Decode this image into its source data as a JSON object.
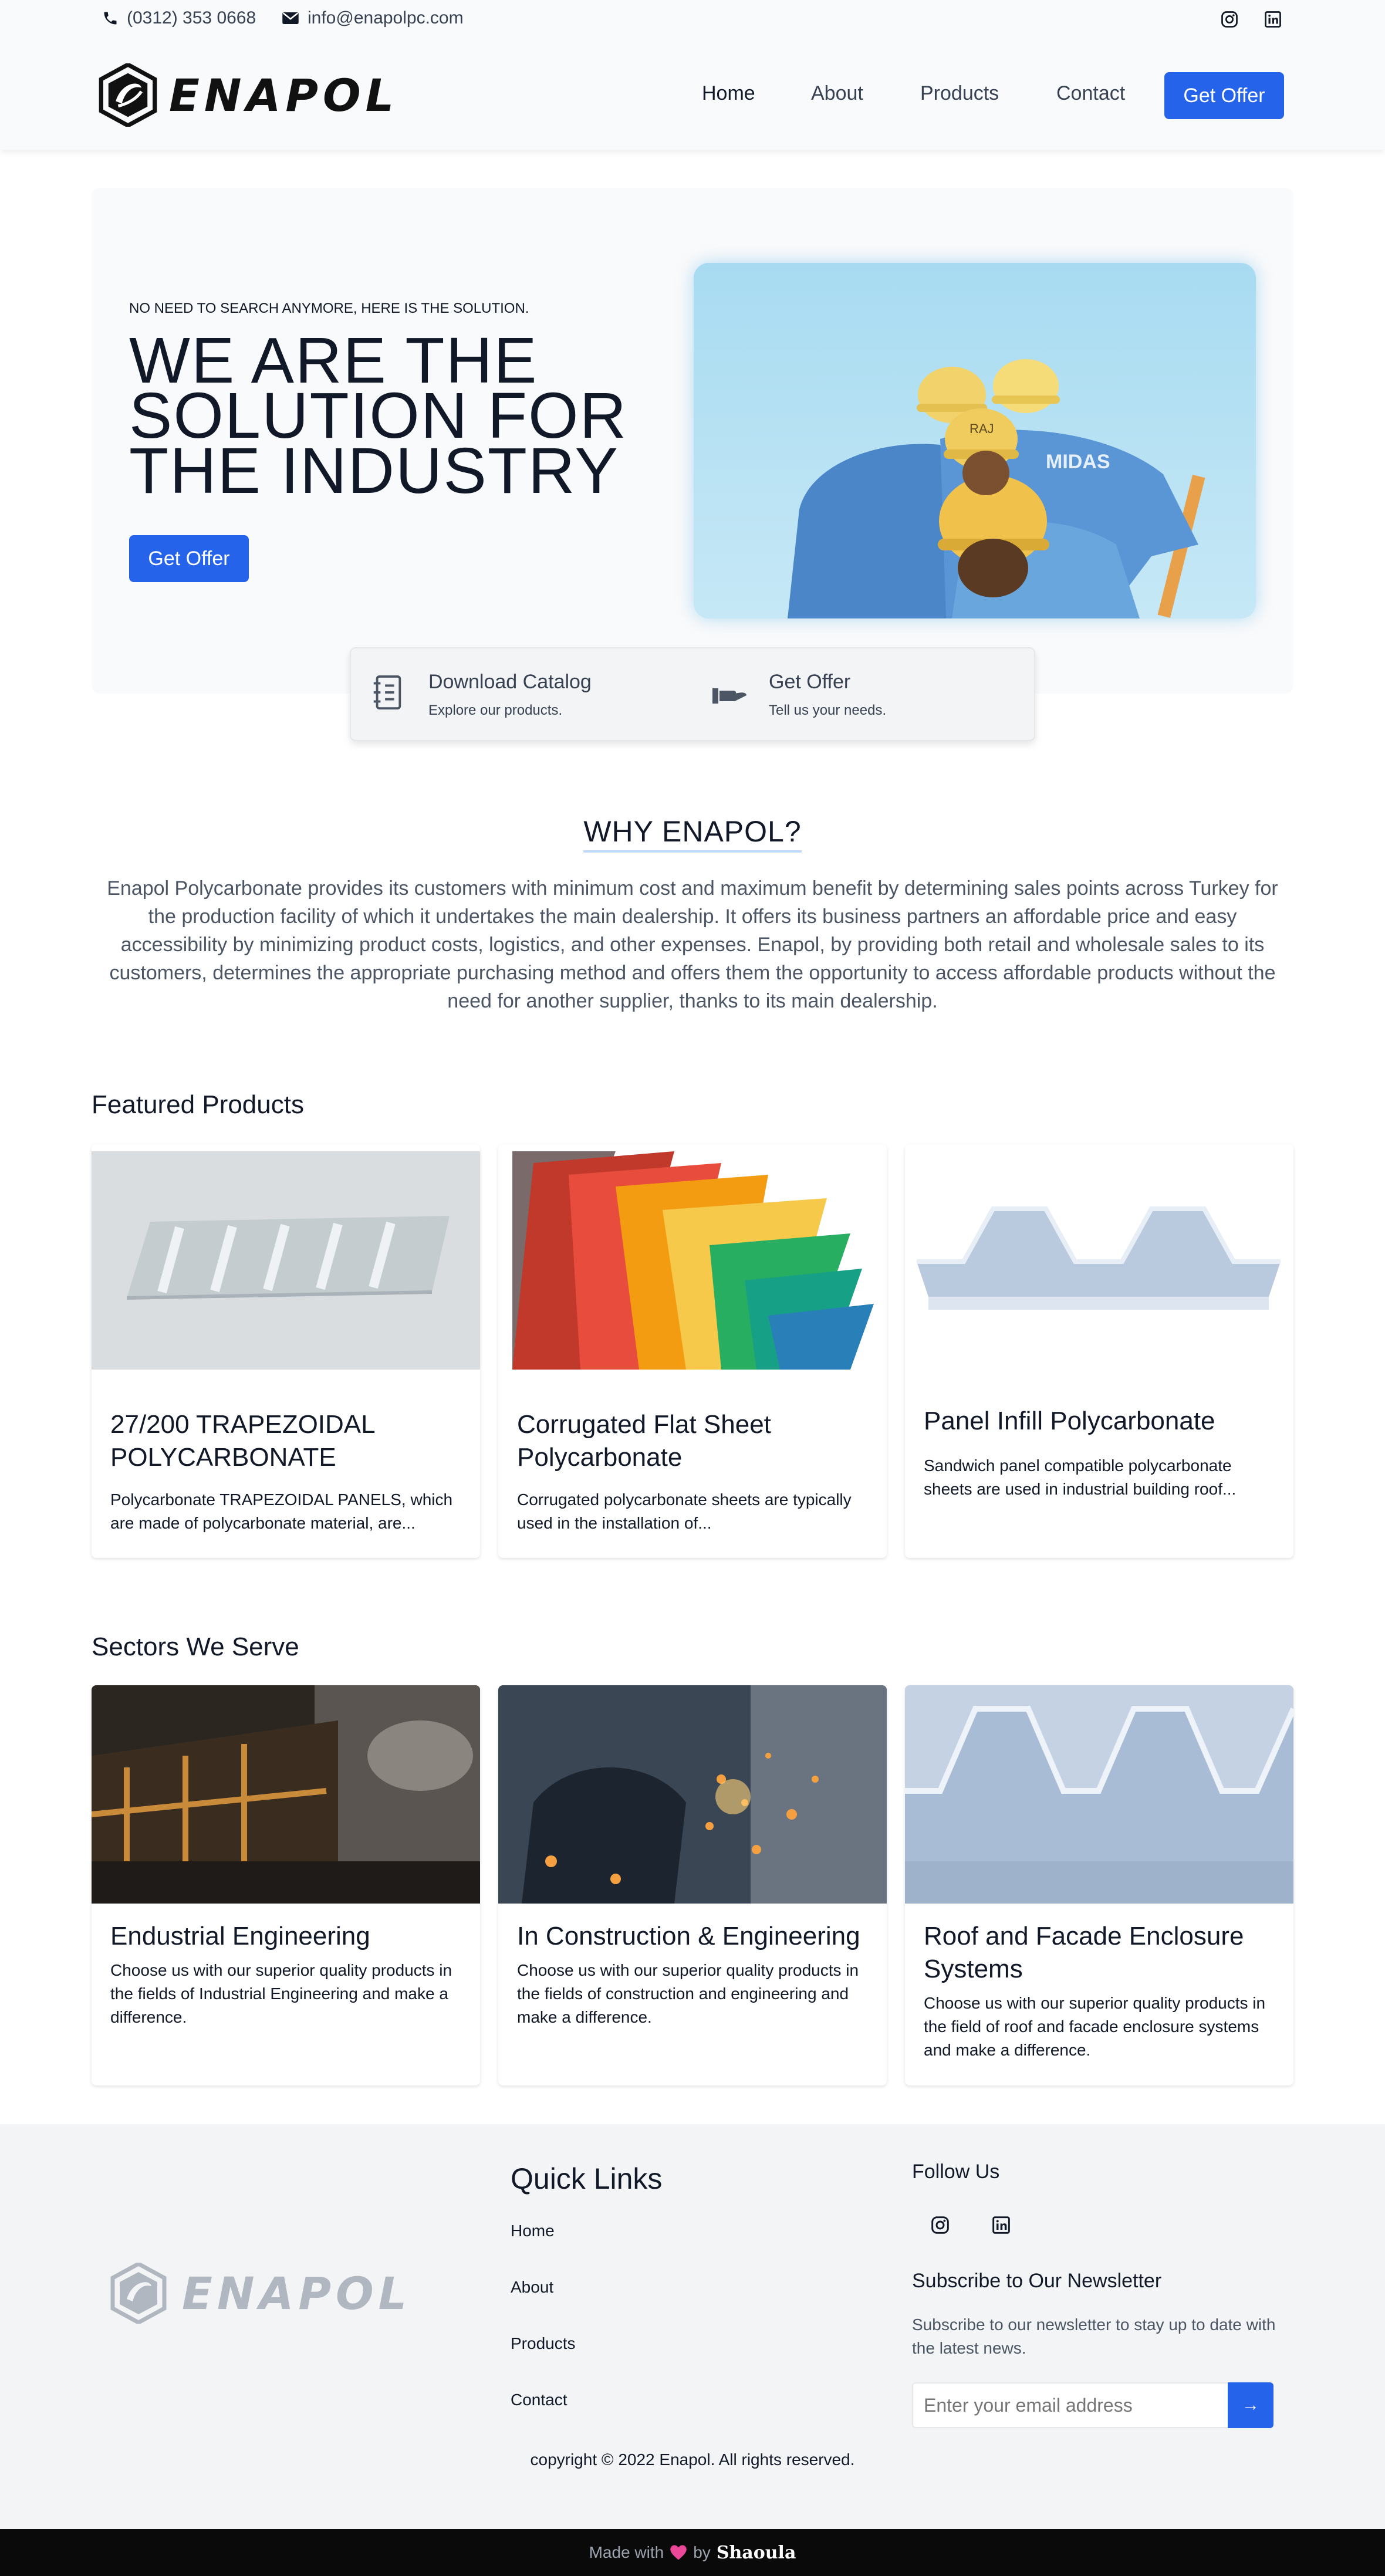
{
  "topbar": {
    "phone": "(0312) 353 0668",
    "email": "info@enapolpc.com"
  },
  "brand": {
    "name": "ENAPOL",
    "logo_icon": "enapol-hexagon-logo"
  },
  "nav": {
    "home": "Home",
    "about": "About",
    "products": "Products",
    "contact": "Contact",
    "cta": "Get Offer"
  },
  "hero": {
    "eyebrow": "NO NEED TO SEARCH ANYMORE, HERE IS THE SOLUTION.",
    "title": "WE ARE THE SOLUTION FOR THE INDUSTRY",
    "cta": "Get Offer"
  },
  "quick": [
    {
      "icon": "catalog-notebook-icon",
      "title": "Download Catalog",
      "subtitle": "Explore our products."
    },
    {
      "icon": "hand-offer-icon",
      "title": "Get Offer",
      "subtitle": "Tell us your needs."
    }
  ],
  "why": {
    "title": "WHY ENAPOL?",
    "body": "Enapol Polycarbonate provides its customers with minimum cost and maximum benefit by determining sales points across Turkey for the production facility of which it undertakes the main dealership. It offers its business partners an affordable price and easy accessibility by minimizing product costs, logistics, and other expenses. Enapol, by providing both retail and wholesale sales to its customers, determines the appropriate purchasing method and offers them the opportunity to access affordable products without the need for another supplier, thanks to its main dealership."
  },
  "featured": {
    "title": "Featured Products",
    "items": [
      {
        "title": "27/200 TRAPEZOIDAL POLYCARBONATE",
        "desc": "Polycarbonate TRAPEZOIDAL PANELS, which are made of polycarbonate material, are..."
      },
      {
        "title": "Corrugated Flat Sheet Polycarbonate",
        "desc": "Corrugated polycarbonate sheets are typically used in the installation of..."
      },
      {
        "title": "Panel Infill Polycarbonate",
        "desc": "Sandwich panel compatible polycarbonate sheets are used in industrial building roof..."
      }
    ]
  },
  "sectors": {
    "title": "Sectors We Serve",
    "items": [
      {
        "title": "Endustrial Engineering",
        "desc": "Choose us with our superior quality products in the fields of Industrial Engineering and make a difference."
      },
      {
        "title": "In Construction & Engineering",
        "desc": "Choose us with our superior quality products in the fields of construction and engineering and make a difference."
      },
      {
        "title": "Roof and Facade Enclosure Systems",
        "desc": "Choose us with our superior quality products in the field of roof and facade enclosure systems and make a difference."
      }
    ]
  },
  "footer": {
    "quick_links_title": "Quick Links",
    "links": [
      "Home",
      "About",
      "Products",
      "Contact"
    ],
    "follow_title": "Follow Us",
    "newsletter_title": "Subscribe to Our Newsletter",
    "newsletter_desc": "Subscribe to our newsletter to stay up to date with the latest news.",
    "email_placeholder": "Enter your email address",
    "submit_arrow": "→",
    "copyright": "copyright © 2022 Enapol. All rights reserved."
  },
  "bottombar": {
    "made_with": "Made with",
    "by": "by",
    "author": "Shaoula"
  },
  "colors": {
    "primary": "#2563eb",
    "heart": "#ec4899",
    "footer_bg": "#f3f4f6"
  }
}
